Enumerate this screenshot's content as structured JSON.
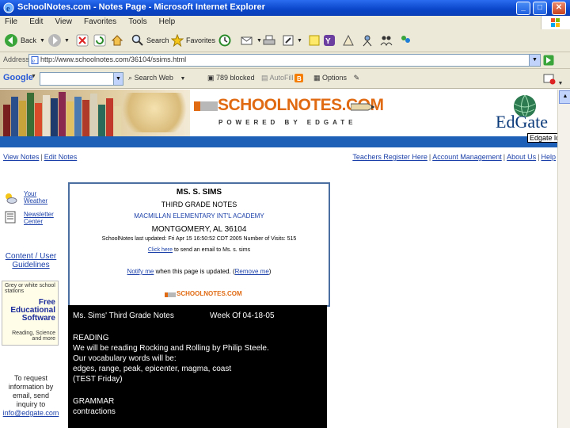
{
  "window": {
    "title": "SchoolNotes.com - Notes Page - Microsoft Internet Explorer",
    "buttons": {
      "minimize": "_",
      "maximize": "□",
      "close": "✕"
    }
  },
  "menu": [
    "File",
    "Edit",
    "View",
    "Favorites",
    "Tools",
    "Help"
  ],
  "toolbar": {
    "back": "Back",
    "search": "Search",
    "favorites": "Favorites"
  },
  "address": {
    "label": "Address",
    "url": "http://www.schoolnotes.com/36104/ssims.html"
  },
  "google_bar": {
    "logo": "Google",
    "search_label": "Search Web",
    "blocked": "789 blocked",
    "autofill": "AutoFill",
    "options": "Options"
  },
  "site": {
    "logo_text": "SCHOOLNOTES.COM",
    "logo_sub": "POWERED BY EDGATE",
    "partner": "EdGate",
    "partner_tag": "Edgate logo",
    "brand_colors": {
      "orange": "#e06a12",
      "blue": "#1e5fb8",
      "navy": "#0b3a7a"
    }
  },
  "nav": {
    "left": [
      "View Notes",
      "Edit Notes"
    ],
    "right": [
      "Teachers Register Here",
      "Account Management",
      "About Us",
      "Help"
    ]
  },
  "sidebar": {
    "weather": "Your Weather",
    "newsletter": "Newsletter Center",
    "guidelines": "Content / User Guidelines",
    "ad_top": "Grey or white school stations",
    "ad_main": "Free Educational Software",
    "ad_sub": "Reading, Science and more",
    "request_text": "To request information by email, send inquiry to",
    "request_email": "info@edgate.com"
  },
  "info": {
    "teacher": "MS. S. SIMS",
    "grade": "THIRD GRADE NOTES",
    "school": "MACMILLAN ELEMENTARY INT'L ACADEMY",
    "city": "MONTGOMERY,   AL   36104",
    "updated": "SchoolNotes last updated: Fri Apr 15 16:50:52 CDT 2005     Number of Visits: 515",
    "email_link": "Click here",
    "email_rest": " to send an email to Ms. s. sims",
    "notify_link": "Notify me",
    "notify_rest": " when this page is updated. (",
    "remove_link": "Remove me",
    "notify_end": ")",
    "small_logo": "SCHOOLNOTES.COM"
  },
  "notes": {
    "heading": "Ms. Sims' Third Grade Notes",
    "week": "Week Of 04-18-05",
    "lines": [
      "READING",
      "We will be reading Rocking and Rolling by Philip Steele.",
      "Our vocabulary words will be:",
      "edges, range, peak, epicenter, magma, coast",
      "(TEST Friday)",
      "",
      "GRAMMAR",
      "contractions"
    ]
  }
}
